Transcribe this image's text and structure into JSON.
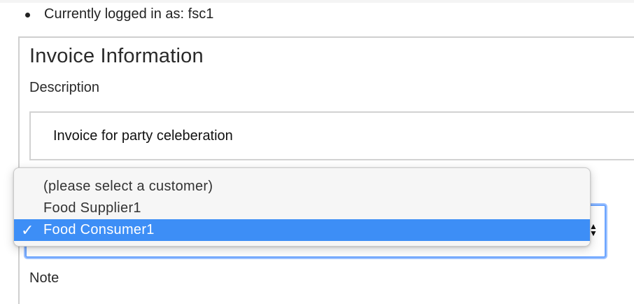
{
  "status": {
    "text": "Currently logged in as: fsc1"
  },
  "invoice": {
    "title": "Invoice Information",
    "description_label": "Description",
    "description_value": "Invoice for party celeberation",
    "note_label": "Note"
  },
  "customer_select": {
    "options": [
      {
        "label": "(please select a customer)",
        "selected": false
      },
      {
        "label": "Food Supplier1",
        "selected": false
      },
      {
        "label": "Food Consumer1",
        "selected": true
      }
    ],
    "check_icon": "checkmark-icon",
    "arrows_icon": "select-arrows-icon",
    "accent_color": "#3d8ef6"
  }
}
